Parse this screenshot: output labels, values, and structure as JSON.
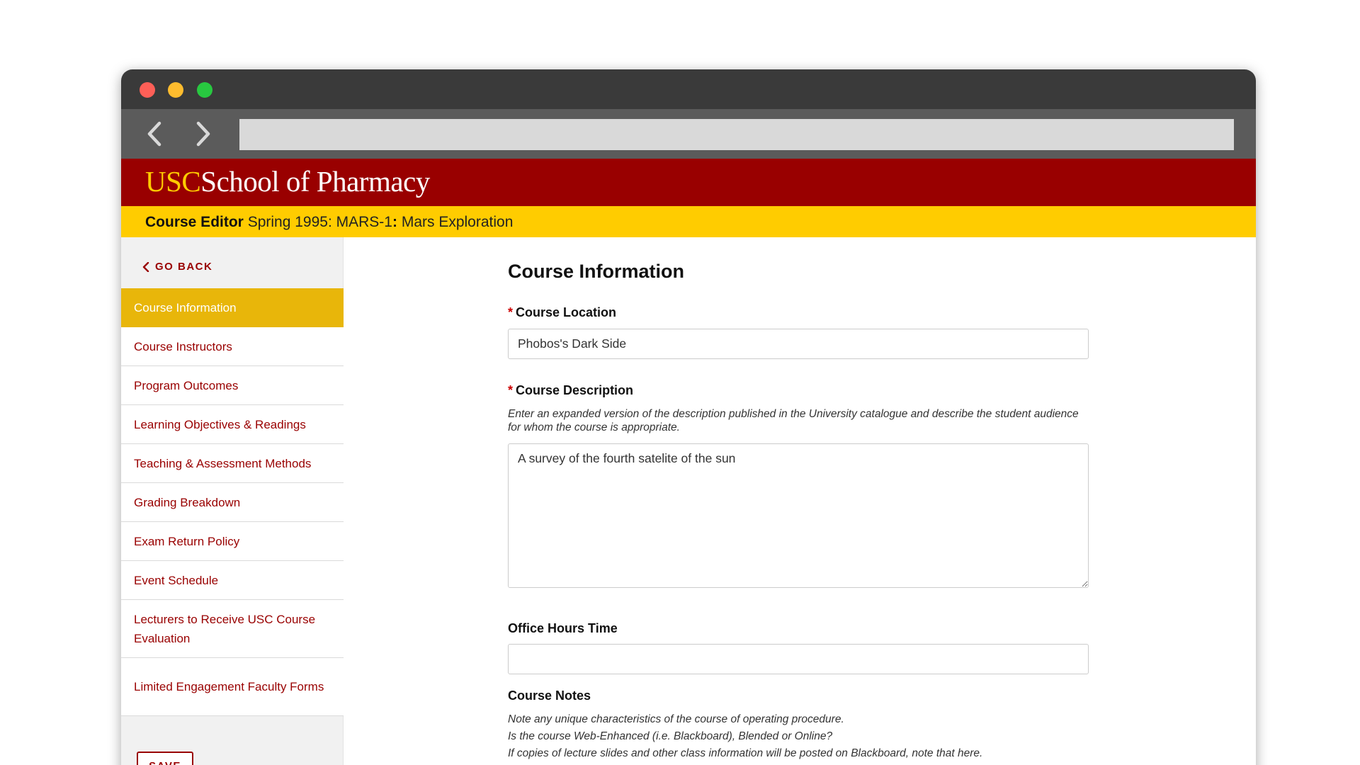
{
  "brand": {
    "usc": "USC",
    "school": "School of Pharmacy",
    "colors": {
      "cardinal": "#990000",
      "gold": "#ffcc00"
    }
  },
  "browser": {
    "icons": [
      "close-dot",
      "minimize-dot",
      "maximize-dot",
      "back-arrow-icon",
      "forward-arrow-icon"
    ],
    "url": ""
  },
  "course_bar": {
    "title": "Course Editor",
    "term_course": "Spring 1995: MARS-1",
    "separator": ":",
    "course_name": "Mars Exploration"
  },
  "sidebar": {
    "go_back": "GO BACK",
    "items": [
      {
        "label": "Course Information",
        "active": true
      },
      {
        "label": "Course Instructors"
      },
      {
        "label": "Program Outcomes"
      },
      {
        "label": "Learning Objectives & Readings"
      },
      {
        "label": "Teaching & Assessment Methods"
      },
      {
        "label": "Grading Breakdown"
      },
      {
        "label": "Exam Return Policy"
      },
      {
        "label": "Event Schedule"
      },
      {
        "label": "Lecturers to Receive USC Course Evaluation"
      },
      {
        "label": "Limited Engagement Faculty Forms"
      }
    ],
    "save_label": "SAVE"
  },
  "form": {
    "heading": "Course Information",
    "required_mark": "*",
    "location": {
      "label": "Course Location",
      "value": "Phobos's Dark Side"
    },
    "description": {
      "label": "Course Description",
      "help": "Enter an expanded version of the description published in the University catalogue and describe the student audience for whom the course is appropriate.",
      "value": "A survey of the fourth satelite of the sun"
    },
    "office_hours": {
      "label": "Office Hours Time",
      "value": ""
    },
    "notes": {
      "label": "Course Notes",
      "help_lines": [
        "Note any unique characteristics of the course of operating procedure.",
        "Is the course Web-Enhanced (i.e. Blackboard), Blended or Online?",
        "If copies of lecture slides and other class information will be posted on Blackboard, note that here."
      ]
    }
  }
}
